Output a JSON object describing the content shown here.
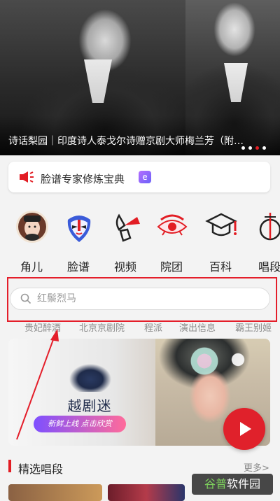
{
  "banner": {
    "caption": "诗话梨园｜印度诗人泰戈尔诗赠京剧大师梅兰芳（附…",
    "page_count": 4,
    "active_page": 3
  },
  "tips": {
    "text": "脸谱专家修炼宝典",
    "badge": "e"
  },
  "categories": [
    {
      "label": "角儿",
      "icon": "opera-character-avatar-icon"
    },
    {
      "label": "脸谱",
      "icon": "opera-mask-icon"
    },
    {
      "label": "视频",
      "icon": "fan-video-icon"
    },
    {
      "label": "院团",
      "icon": "eye-troupe-icon"
    },
    {
      "label": "百科",
      "icon": "mortarboard-icon"
    },
    {
      "label": "唱段",
      "icon": "lute-icon"
    }
  ],
  "search": {
    "placeholder": "红鬃烈马"
  },
  "hot_keywords": [
    "贵妃醉酒",
    "北京京剧院",
    "程派",
    "演出信息",
    "霸王别姬"
  ],
  "ad": {
    "title": "越剧迷",
    "tagline": "新鲜上线  点击欣赏"
  },
  "section": {
    "title": "精选唱段",
    "more": "更多>"
  },
  "watermark": {
    "part1": "谷普",
    "part2": "软件园"
  },
  "colors": {
    "accent": "#e21d24",
    "highlight_border": "#e41e2a"
  }
}
